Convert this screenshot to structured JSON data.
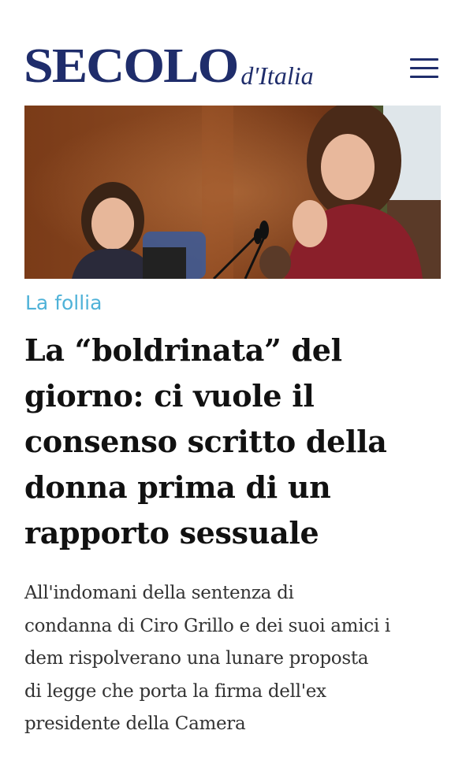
{
  "header": {
    "logo_main": "SECOLO",
    "logo_sub": "d'Italia",
    "brand_color": "#1f2d6b",
    "menu_icon": "hamburger-menu-icon"
  },
  "article": {
    "category": "La follia",
    "category_color": "#4fb2d8",
    "headline_lines": [
      "La “boldrinata” del",
      "giorno: ci vuole il",
      "consenso scritto della",
      "donna prima di un",
      "rapporto sessuale"
    ],
    "summary_lines": [
      "All'indomani della sentenza di",
      "condanna di Ciro Grillo e dei suoi amici i",
      "dem rispolverano una lunare proposta",
      "di legge che porta la firma dell'ex",
      "presidente della Camera"
    ]
  }
}
